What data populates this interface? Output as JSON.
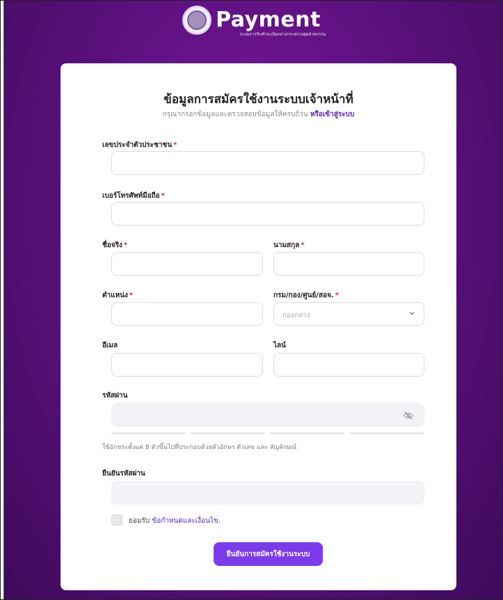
{
  "header": {
    "brand": "Payment",
    "subtitle": "ระบบการรับชำระเงินกลางกระทรวงอุตสาหกรรม"
  },
  "form": {
    "title": "ข้อมูลการสมัครใช้งานระบบเจ้าหน้าที่",
    "hint": "กรุณากรอกข้อมูลและตรวจสอบข้อมูลให้ครบถ้วน",
    "login_link": "หรือเข้าสู่ระบบ",
    "required_mark": "*",
    "fields": {
      "citizen_id": {
        "label": "เลขประจำตัวประชาชน",
        "value": ""
      },
      "phone": {
        "label": "เบอร์โทรศัพท์มือถือ",
        "value": ""
      },
      "first_name": {
        "label": "ชื่อจริง",
        "value": ""
      },
      "last_name": {
        "label": "นามสกุล",
        "value": ""
      },
      "position": {
        "label": "ตำแหน่ง",
        "value": ""
      },
      "department": {
        "label": "กรม/กอง/ศูนย์/สอจ.",
        "selected": "กองกลาง"
      },
      "email": {
        "label": "อีเมล",
        "value": ""
      },
      "line": {
        "label": "ไลน์",
        "value": ""
      },
      "password": {
        "label": "รหัสผ่าน",
        "help": "ใช้อักขระตั้งแต่ 8 ตัวขึ้นไปที่ประกอบด้วยตัวอักษร ตัวเลข และ สัญลักษณ์",
        "strength_segments": 4
      },
      "confirm_password": {
        "label": "ยืนยันรหัสผ่าน",
        "value": ""
      }
    },
    "terms": {
      "accept": "ยอมรับ",
      "link": "ข้อกำหนดและเงื่อนไข."
    },
    "submit_label": "ยืนยันการสมัครใช้งานระบบ"
  },
  "colors": {
    "accent": "#7c3aed",
    "link": "#5b21b6",
    "required": "#e11d48",
    "background": "#5e1180"
  },
  "icons": [
    "ministry-seal-logo",
    "eye-off-icon",
    "chevron-down-icon"
  ]
}
